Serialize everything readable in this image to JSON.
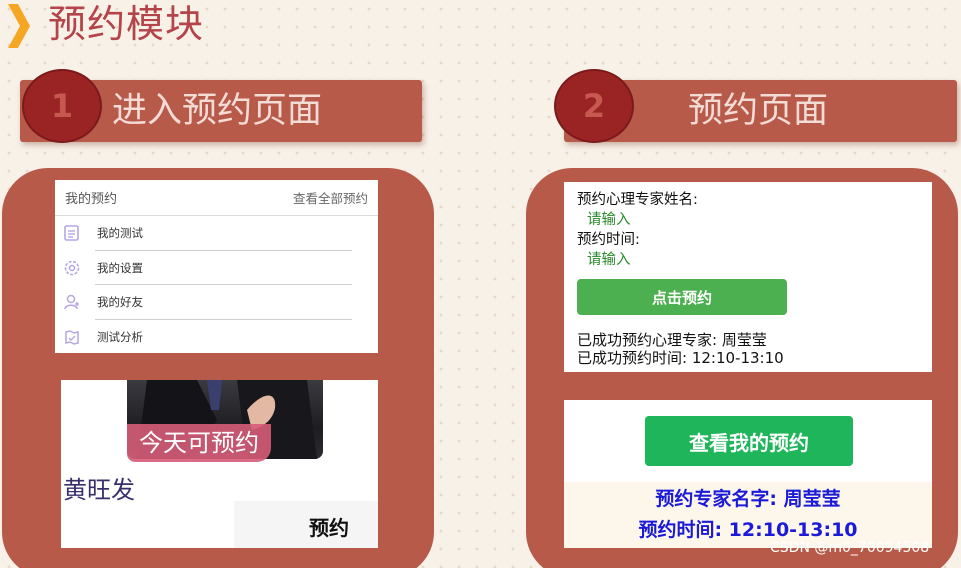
{
  "page": {
    "title": "预约模块"
  },
  "steps": [
    {
      "number": "1",
      "label": "进入预约页面"
    },
    {
      "number": "2",
      "label": "预约页面"
    }
  ],
  "my_appointments": {
    "header": "我的预约",
    "view_all": "查看全部预约",
    "items": [
      {
        "label": "我的测试",
        "icon": "test-icon"
      },
      {
        "label": "我的设置",
        "icon": "settings-icon"
      },
      {
        "label": "我的好友",
        "icon": "friends-icon"
      },
      {
        "label": "测试分析",
        "icon": "analysis-icon"
      }
    ]
  },
  "doctor_card": {
    "available_tag": "今天可预约",
    "name": "黄旺发",
    "reserve_label": "预约"
  },
  "booking_form": {
    "expert_name_label": "预约心理专家姓名:",
    "expert_name_placeholder": "请输入",
    "time_label": "预约时间:",
    "time_placeholder": "请输入",
    "submit_label": "点击预约",
    "success_expert": "已成功预约心理专家: 周莹莹",
    "success_time": "已成功预约时间: 12:10-13:10"
  },
  "my_booking": {
    "button_label": "查看我的预约",
    "expert_line": "预约专家名字: 周莹莹",
    "time_line": "预约时间: 12:10-13:10"
  },
  "watermark": "CSDN @m0_70094508",
  "colors": {
    "accent": "#b85a4a",
    "title": "#b4434a",
    "circle": "#9a2424",
    "green_button": "#4caf50",
    "green_button2": "#1fb55a",
    "info_blue": "#1a1ad8"
  }
}
